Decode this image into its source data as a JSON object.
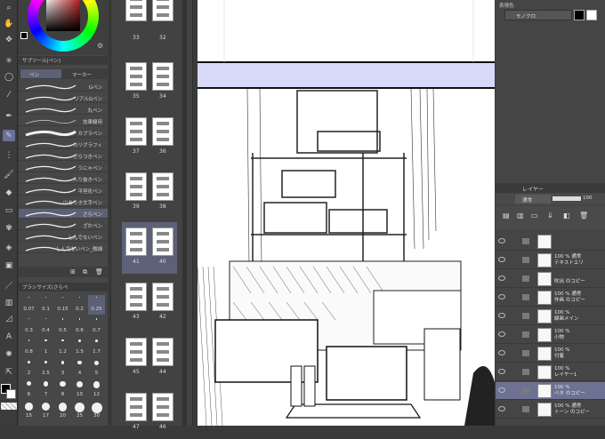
{
  "brush_panel": {
    "tab_subtool": "サブツール[ペン]",
    "tab_pen": "ペン",
    "tab_marker": "マーカー",
    "brushes": [
      {
        "label": "Gペン"
      },
      {
        "label": "リアルGペン"
      },
      {
        "label": "丸ペン"
      },
      {
        "label": "効果線用"
      },
      {
        "label": "カブラペン"
      },
      {
        "label": "カリグラフィ"
      },
      {
        "label": "ざらつきペン"
      },
      {
        "label": "うにゃペン"
      },
      {
        "label": "入り抜きペン"
      },
      {
        "label": "平坦化ペン"
      },
      {
        "label": "山ありき文字ペン"
      },
      {
        "label": "さらペン",
        "selected": true
      },
      {
        "label": "ざかペン"
      },
      {
        "label": "しんでないペン"
      },
      {
        "label": "しんでないペン_微細"
      }
    ]
  },
  "size_palette": {
    "header": "ブラシサイズ(さらペ",
    "sizes": [
      "0.07",
      "0.1",
      "0.15",
      "0.2",
      "0.25",
      "0.3",
      "0.4",
      "0.5",
      "0.6",
      "0.7",
      "0.8",
      "1",
      "1.2",
      "1.5",
      "1.7",
      "2",
      "2.5",
      "3",
      "4",
      "5",
      "6",
      "7",
      "8",
      "10",
      "12",
      "15",
      "17",
      "20",
      "25",
      "30"
    ],
    "selected_size": "0.25"
  },
  "pages": [
    {
      "left": "33",
      "right": "32"
    },
    {
      "left": "35",
      "right": "34"
    },
    {
      "left": "37",
      "right": "36"
    },
    {
      "left": "39",
      "right": "38"
    },
    {
      "left": "41",
      "right": "40",
      "selected": true
    },
    {
      "left": "43",
      "right": "42"
    },
    {
      "left": "45",
      "right": "44"
    },
    {
      "left": "47",
      "right": "46"
    }
  ],
  "color_panel": {
    "title": "表現色",
    "mode": "モノクロ"
  },
  "layer_panel": {
    "title": "レイヤー",
    "blend_mode": "通常",
    "opacity": "100",
    "layers": [
      {
        "l1": "",
        "l2": ""
      },
      {
        "l1": "100 % 通常",
        "l2": "テキストエリ"
      },
      {
        "l1": "",
        "l2": "吹出 のコピー"
      },
      {
        "l1": "100 % 通常",
        "l2": "作画 のコピー"
      },
      {
        "l1": "100 %",
        "l2": "線画メイン"
      },
      {
        "l1": "100 %",
        "l2": "小物"
      },
      {
        "l1": "100 %",
        "l2": "付着"
      },
      {
        "l1": "100 %",
        "l2": "レイヤー1"
      },
      {
        "l1": "100 %",
        "l2": "ベタ のコピー",
        "selected": true
      },
      {
        "l1": "100 % 通常",
        "l2": "トーン のコピー"
      }
    ]
  },
  "accent": "#6a6f9a"
}
